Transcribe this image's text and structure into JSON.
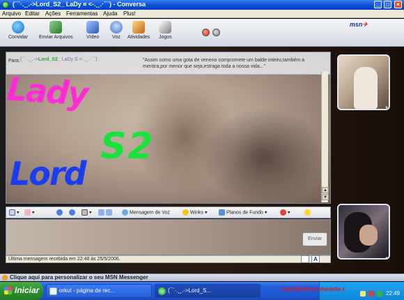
{
  "window": {
    "title": "(¯`·.¸¸.->Lord_S2_ LaDy ¤ <-.¸¸.·´¯) - Conversa",
    "min": "_",
    "max": "□",
    "close": "×"
  },
  "menu": [
    "Arquivo",
    "Editar",
    "Ações",
    "Ferramentas",
    "Ajuda",
    "Plus!"
  ],
  "toolbar": {
    "invite": "Convidar",
    "send_files": "Enviar Arquivos",
    "video": "Vídeo",
    "voice": "Voz",
    "activities": "Atividades",
    "games": "Jogos",
    "logo": "msn",
    "logo_mark": "✈"
  },
  "chat": {
    "to_label": "Para:",
    "contact_prefix": "(¯`·.¸¸.->",
    "contact_highlight": "Lord_S2_",
    "contact_suffix": " LaDy S <-.¸¸.·´¯)",
    "status_quote": "\"Assim como uma gota de veneno compromete um balde inteiro,também a mentira,por menor que seja,estraga toda a nossa vida...\"",
    "scroll_up": "▲",
    "scroll_down": "▼"
  },
  "drawing": {
    "word1": "Lady",
    "word2": "S2",
    "word3": "Lord",
    "colors": {
      "lady": "#ff2bd6",
      "s2": "#17e33a",
      "lord": "#1a3df0"
    }
  },
  "format": {
    "voice_clip": "Mensagem de Voz",
    "winks": "Winks",
    "backgrounds": "Planos de Fundo"
  },
  "input": {
    "send": "Enviar",
    "last_message": "Última mensagem recebida em 22:48 às 25/5/2006.",
    "font_button": "A"
  },
  "customize": "Clique aqui para personalizar o seu MSN Messenger",
  "taskbar": {
    "start": "Iniciar",
    "tasks": [
      {
        "label": "orkut - página de rec..."
      },
      {
        "label": "(¯`·.¸¸.->Lord_S..."
      }
    ],
    "watermark": "CaroDiloforos.danielle.t",
    "clock": "22:49"
  }
}
